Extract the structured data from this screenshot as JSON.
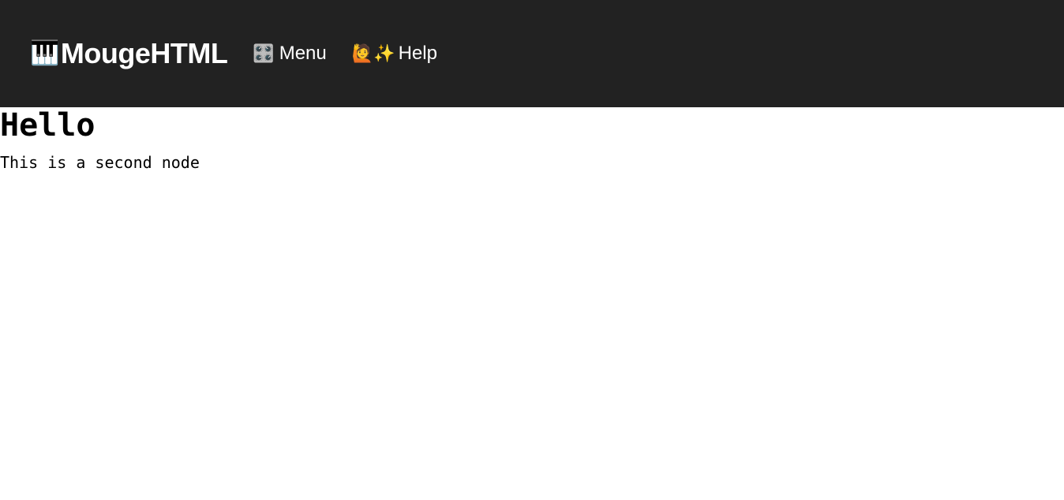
{
  "header": {
    "brand": {
      "icon": "🎹",
      "label": "MougeHTML"
    },
    "nav": [
      {
        "icon": "🎛️",
        "label": "Menu"
      },
      {
        "icon": "🙋✨",
        "label": "Help"
      }
    ]
  },
  "main": {
    "heading": "Hello",
    "paragraph": "This is a second node"
  },
  "colors": {
    "topbar_bg": "#222222",
    "topbar_text": "#ffffff",
    "page_bg": "#ffffff",
    "page_text": "#000000"
  }
}
